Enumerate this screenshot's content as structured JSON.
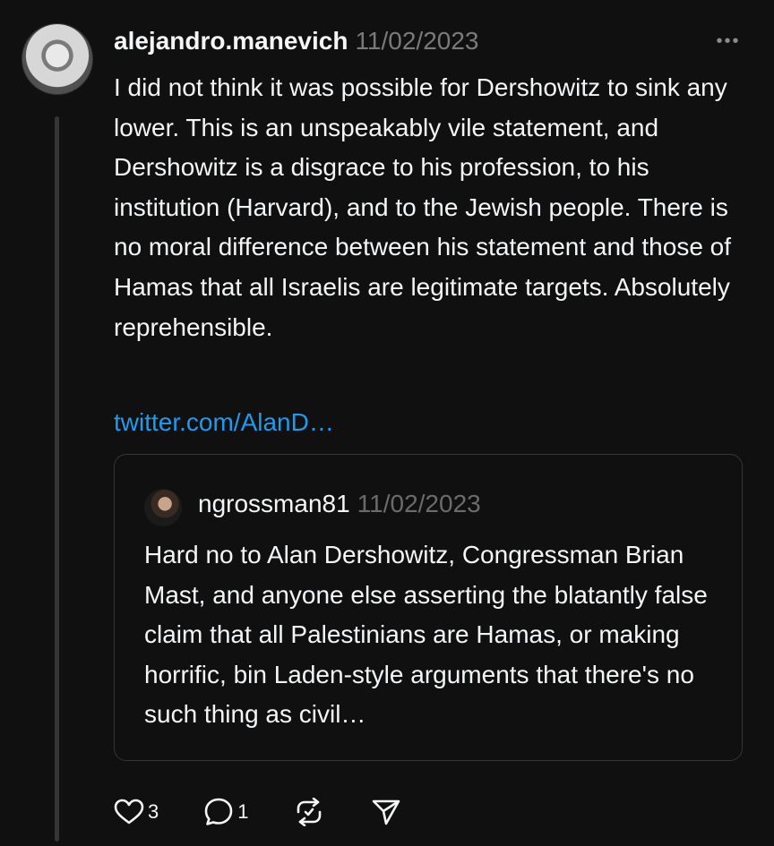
{
  "post": {
    "username": "alejandro.manevich",
    "date": "11/02/2023",
    "more_label": "•••",
    "text": "I did not think it was possible for Dershowitz to sink any lower. This is an unspeakably vile statement, and Dershowitz is a disgrace to his profession, to his institution (Harvard), and to the Jewish people. There is no moral difference between his statement and those of Hamas that all Israelis are legitimate targets. Absolutely reprehensible.",
    "link_text": "twitter.com/AlanD…"
  },
  "quote": {
    "username": "ngrossman81",
    "date": "11/02/2023",
    "text": "Hard no to Alan Dershowitz, Congressman Brian Mast, and anyone else asserting the blatantly false claim that all Palestinians are Hamas, or making horrific, bin Laden-style arguments that there's no such thing as civil…"
  },
  "actions": {
    "likes": "3",
    "replies": "1",
    "icons": [
      "heart-icon",
      "reply-icon",
      "repost-icon",
      "share-icon"
    ]
  },
  "colors": {
    "background": "#101010",
    "text": "#f3f5f7",
    "muted": "#7a7a7a",
    "link": "#1d9bf0",
    "border": "#333638"
  }
}
